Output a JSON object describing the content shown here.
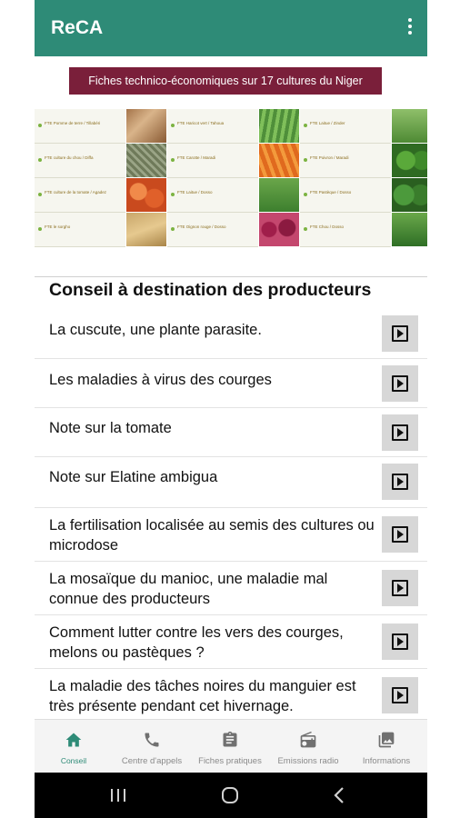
{
  "app": {
    "title": "ReCA"
  },
  "banner": {
    "title": "Fiches technico-économiques sur 17 cultures du Niger",
    "columns": [
      {
        "sheets": [
          "FTE Pomme de terre / Tillabéri",
          "FTE culture du chou / Diffa",
          "FTE culture de la tomate / Agadez",
          "FTE le sorgho"
        ]
      },
      {
        "sheets": [
          "FTE Haricot vert / Tahoua",
          "FTE Carotte / Maradi",
          "FTE Laitue / Dosso",
          "FTE Oignon rouge / Dosso"
        ]
      },
      {
        "sheets": [
          "FTE Laitue / Zinder",
          "FTE Poivron / Maradi",
          "FTE Pastèque / Dosso",
          "FTE Chou / Dosso"
        ]
      }
    ]
  },
  "section": {
    "title": "Conseil à destination des producteurs"
  },
  "items": [
    {
      "label": "La cuscute, une plante parasite."
    },
    {
      "label": "Les maladies à virus des courges"
    },
    {
      "label": "Note sur la tomate"
    },
    {
      "label": "Note sur Elatine ambigua"
    },
    {
      "label": "La fertilisation localisée au semis des cultures ou microdose"
    },
    {
      "label": "La mosaïque du manioc, une maladie mal connue des producteurs"
    },
    {
      "label": "Comment lutter contre les vers des courges, melons ou pastèques ?"
    },
    {
      "label": "La maladie des tâches noires du manguier est très présente pendant cet hivernage."
    }
  ],
  "nav": [
    {
      "label": "Conseil",
      "icon": "home-icon"
    },
    {
      "label": "Centre d'appels",
      "icon": "phone-icon"
    },
    {
      "label": "Fiches pratiques",
      "icon": "clipboard-icon"
    },
    {
      "label": "Emissions radio",
      "icon": "radio-icon"
    },
    {
      "label": "Informations",
      "icon": "image-gallery-icon"
    }
  ],
  "colors": {
    "primary": "#2e8b77",
    "banner_title_bg": "#7a1f3a",
    "play_bg": "#d7d7d7"
  }
}
